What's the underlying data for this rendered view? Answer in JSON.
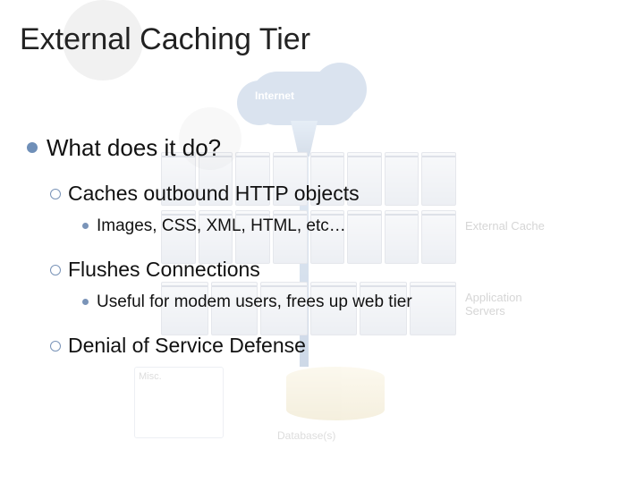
{
  "title": "External Caching Tier",
  "bullets": {
    "lvl1": "What does it do?",
    "b1": {
      "lvl2": "Caches outbound HTTP objects",
      "lvl3": "Images, CSS, XML, HTML, etc…"
    },
    "b2": {
      "lvl2": "Flushes Connections",
      "lvl3": "Useful for modem users, frees up web tier"
    },
    "b3": {
      "lvl2": "Denial of Service Defense"
    }
  },
  "backdrop": {
    "cloud": "Internet",
    "label_external_cache": "External Cache",
    "label_app_servers": "Application Servers",
    "misc": "Misc.",
    "db": "Database(s)"
  }
}
